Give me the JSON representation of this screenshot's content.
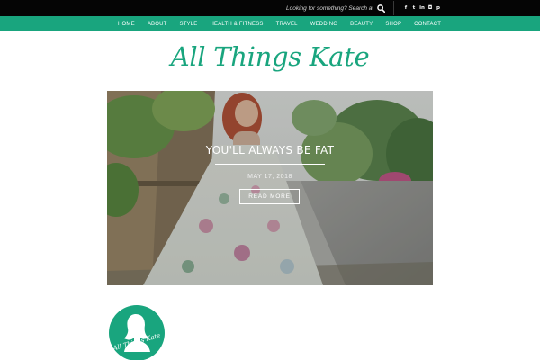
{
  "topbar": {
    "search_placeholder": "Looking for something? Search away!",
    "search_icon": "search-icon",
    "social_icons": [
      "facebook-icon",
      "twitter-icon",
      "linkedin-icon",
      "instagram-icon",
      "pinterest-icon"
    ],
    "social_glyphs": [
      "f",
      "t",
      "in",
      "◘",
      "p"
    ]
  },
  "nav": {
    "items": [
      "HOME",
      "ABOUT",
      "STYLE",
      "HEALTH & FITNESS",
      "TRAVEL",
      "WEDDING",
      "BEAUTY",
      "SHOP",
      "CONTACT"
    ]
  },
  "site": {
    "logo_text": "All Things Kate",
    "circle_logo_text": "All Things Kate"
  },
  "hero": {
    "title": "YOU'LL ALWAYS BE FAT",
    "date": "MAY 17, 2018",
    "read_more_label": "READ MORE"
  },
  "colors": {
    "accent": "#19a57e",
    "topbar": "#050505"
  }
}
